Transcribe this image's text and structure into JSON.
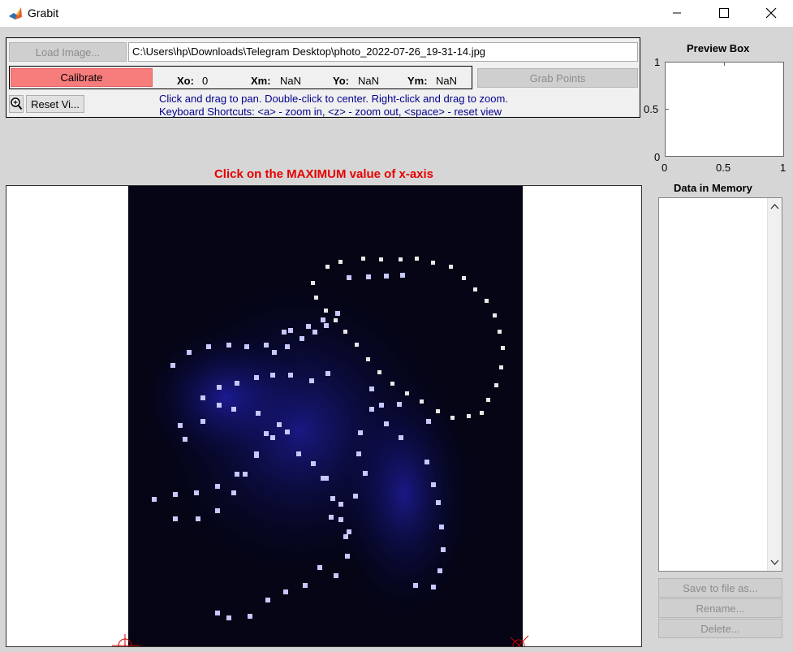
{
  "window": {
    "title": "Grabit",
    "icon": "matlab-icon"
  },
  "controls": {
    "load_image_label": "Load Image...",
    "file_path": "C:\\Users\\hp\\Downloads\\Telegram Desktop\\photo_2022-07-26_19-31-14.jpg",
    "calibrate_label": "Calibrate",
    "xo_label": "Xo:",
    "xo_value": "0",
    "xm_label": "Xm:",
    "xm_value": "NaN",
    "yo_label": "Yo:",
    "yo_value": "NaN",
    "ym_label": "Ym:",
    "ym_value": "NaN",
    "grab_points_label": "Grab Points",
    "reset_view_label": "Reset Vi...",
    "hint_line1": "Click and drag to pan. Double-click to center. Right-click and drag to zoom.",
    "hint_line2": "Keyboard Shortcuts: <a> - zoom in, <z> - zoom out, <space> - reset view"
  },
  "status_message": "Click on the MAXIMUM value of x-axis",
  "preview": {
    "title": "Preview Box",
    "y_ticks": [
      "1",
      "0.5",
      "0"
    ],
    "x_ticks": [
      "0",
      "0.5",
      "1"
    ]
  },
  "memory": {
    "title": "Data in Memory",
    "save_label": "Save to file as...",
    "rename_label": "Rename...",
    "delete_label": "Delete..."
  },
  "colors": {
    "calibrate_bg": "#f77c7c",
    "status_text": "#e60000",
    "hint_text": "#00008b",
    "marker": "#cc0000"
  }
}
